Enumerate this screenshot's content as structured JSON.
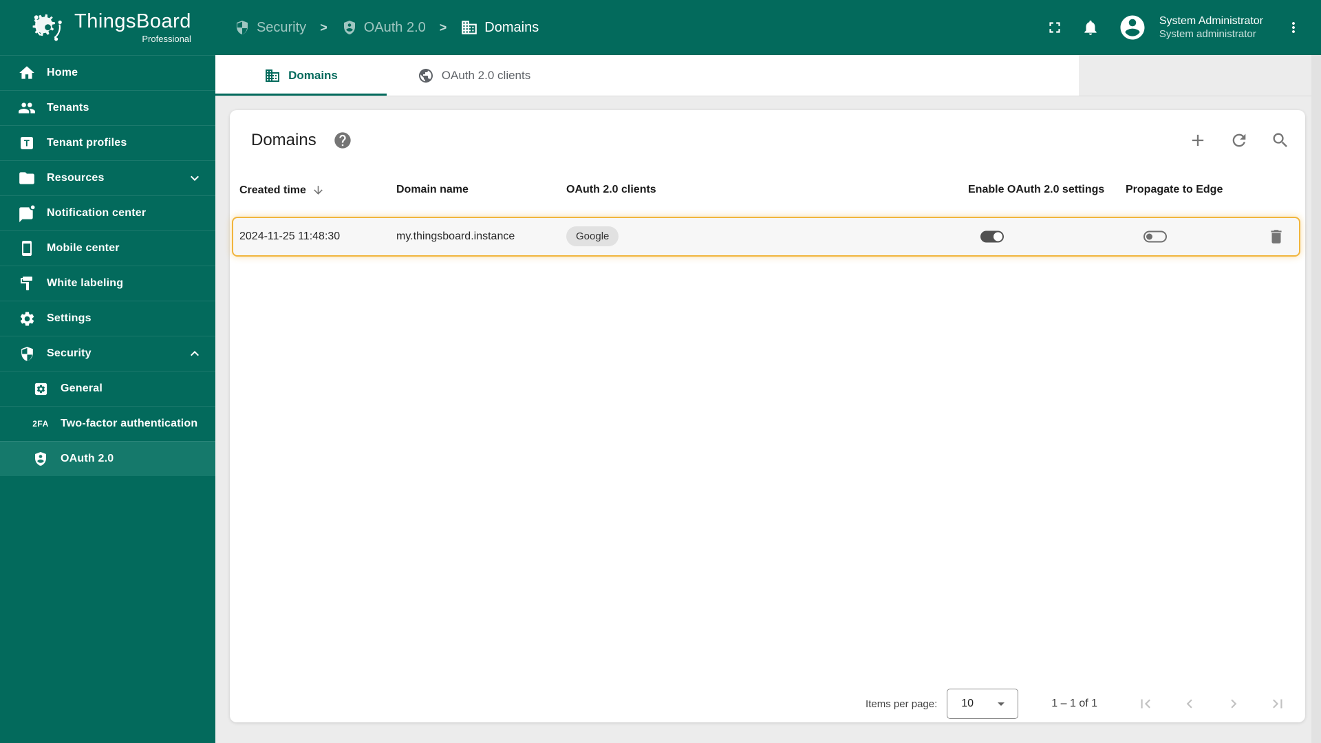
{
  "brand": {
    "name": "ThingsBoard",
    "edition": "Professional"
  },
  "breadcrumb": {
    "separator": ">",
    "items": [
      {
        "label": "Security",
        "icon": "security-shield-icon"
      },
      {
        "label": "OAuth 2.0",
        "icon": "shield-person-icon"
      },
      {
        "label": "Domains",
        "icon": "domain-icon"
      }
    ]
  },
  "header": {
    "user_name": "System Administrator",
    "user_role": "System administrator"
  },
  "sidebar": {
    "tenant_profile_icon_letter": "T",
    "two_fa_icon_label": "2FA",
    "items": [
      {
        "label": "Home"
      },
      {
        "label": "Tenants"
      },
      {
        "label": "Tenant profiles"
      },
      {
        "label": "Resources",
        "expandable": true,
        "expanded": false
      },
      {
        "label": "Notification center"
      },
      {
        "label": "Mobile center"
      },
      {
        "label": "White labeling"
      },
      {
        "label": "Settings"
      },
      {
        "label": "Security",
        "expandable": true,
        "expanded": true
      },
      {
        "label": "General",
        "sub": true
      },
      {
        "label": "Two-factor authentication",
        "sub": true
      },
      {
        "label": "OAuth 2.0",
        "sub": true,
        "selected": true
      }
    ]
  },
  "tabs": [
    {
      "label": "Domains",
      "active": true
    },
    {
      "label": "OAuth 2.0 clients",
      "active": false
    }
  ],
  "panel": {
    "title": "Domains"
  },
  "table": {
    "columns": [
      "Created time",
      "Domain name",
      "OAuth 2.0 clients",
      "Enable OAuth 2.0 settings",
      "Propagate to Edge"
    ],
    "sort_column": "Created time",
    "sort_direction": "desc",
    "rows": [
      {
        "created_time": "2024-11-25 11:48:30",
        "domain_name": "my.thingsboard.instance",
        "clients": [
          "Google"
        ],
        "oauth_enabled": true,
        "propagate_to_edge": false
      }
    ]
  },
  "paginator": {
    "items_per_page_label": "Items per page:",
    "page_size": "10",
    "range_label": "1 – 1 of 1"
  },
  "colors": {
    "primary": "#036a5c",
    "sidebar_selected": "#15796b",
    "row_highlight_border": "#f1b53d"
  }
}
